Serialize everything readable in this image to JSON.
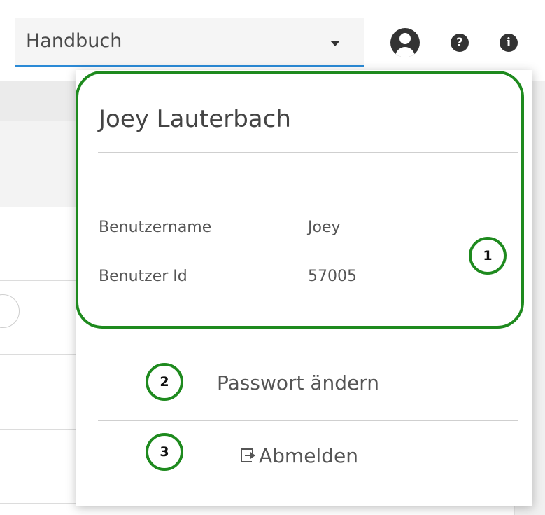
{
  "header": {
    "select_value": "Handbuch",
    "icons": [
      "user-icon",
      "help-icon",
      "info-icon"
    ],
    "help_glyph": "?",
    "info_glyph": "i"
  },
  "user_menu": {
    "name": "Joey Lauterbach",
    "fields": [
      {
        "label": "Benutzername",
        "value": "Joey"
      },
      {
        "label": "Benutzer Id",
        "value": "57005"
      }
    ],
    "change_password_label": "Passwort ändern",
    "logout_label": "Abmelden"
  },
  "markers": [
    "1",
    "2",
    "3"
  ],
  "colors": {
    "highlight": "#1e8a1e",
    "accent": "#2b8ad6"
  }
}
